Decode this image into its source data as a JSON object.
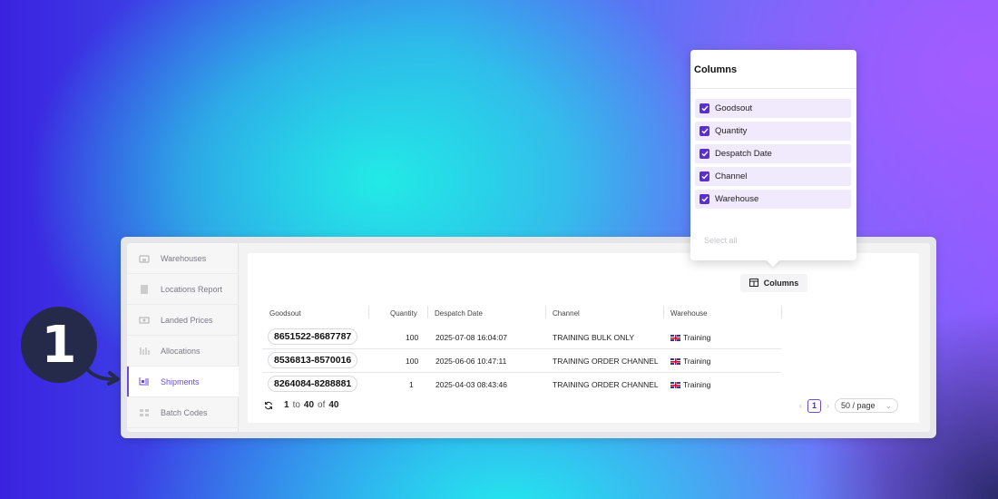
{
  "step_number": "1",
  "sidebar": {
    "items": [
      {
        "label": "Warehouses",
        "icon": "warehouse-icon",
        "active": false
      },
      {
        "label": "Locations Report",
        "icon": "report-icon",
        "active": false
      },
      {
        "label": "Landed Prices",
        "icon": "price-tag-icon",
        "active": false
      },
      {
        "label": "Allocations",
        "icon": "allocations-icon",
        "active": false
      },
      {
        "label": "Shipments",
        "icon": "shipments-icon",
        "active": true
      },
      {
        "label": "Batch Codes",
        "icon": "batch-codes-icon",
        "active": false
      }
    ]
  },
  "toolbar": {
    "columns_label": "Columns"
  },
  "table": {
    "headers": [
      "Goodsout",
      "Quantity",
      "Despatch Date",
      "Channel",
      "Warehouse"
    ],
    "rows": [
      {
        "goodsout": "8651522-8687787",
        "quantity": "100",
        "despatch_date": "2025-07-08 16:04:07",
        "channel": "TRAINING BULK ONLY",
        "warehouse": "Training"
      },
      {
        "goodsout": "8536813-8570016",
        "quantity": "100",
        "despatch_date": "2025-06-06 10:47:11",
        "channel": "TRAINING ORDER CHANNEL",
        "warehouse": "Training"
      },
      {
        "goodsout": "8264084-8288881",
        "quantity": "1",
        "despatch_date": "2025-04-03 08:43:46",
        "channel": "TRAINING ORDER CHANNEL",
        "warehouse": "Training"
      }
    ]
  },
  "footer": {
    "range_start": "1",
    "range_to": "to",
    "range_end": "40",
    "of_label": "of",
    "total": "40",
    "current_page": "1",
    "page_size": "50 / page"
  },
  "columns_dropdown": {
    "title": "Columns",
    "options": [
      {
        "label": "Goodsout",
        "checked": true
      },
      {
        "label": "Quantity",
        "checked": true
      },
      {
        "label": "Despatch Date",
        "checked": true
      },
      {
        "label": "Channel",
        "checked": true
      },
      {
        "label": "Warehouse",
        "checked": true
      }
    ],
    "select_all_label": "Select all"
  },
  "colors": {
    "accent": "#6b4bd8",
    "checkbox": "#5a2fd0",
    "badge": "#252a4a"
  }
}
